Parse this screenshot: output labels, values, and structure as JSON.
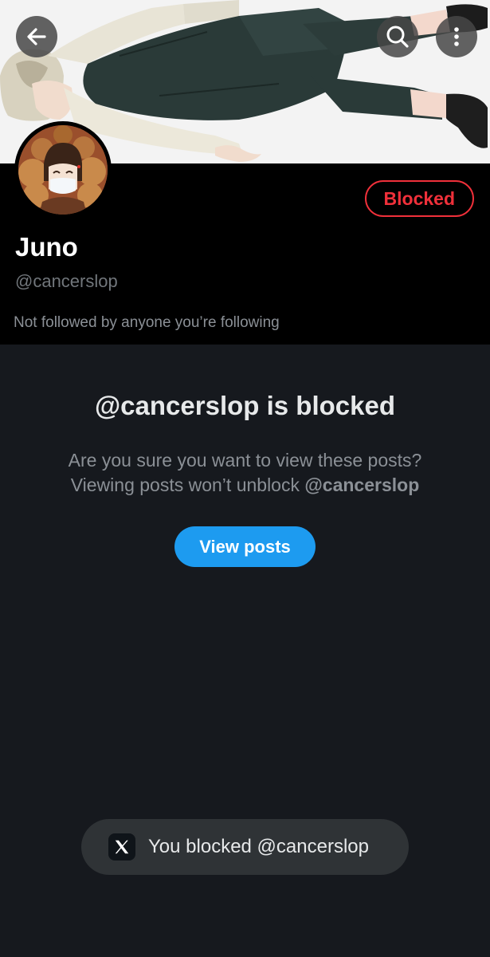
{
  "profile": {
    "display_name": "Juno",
    "handle": "@cancerslop",
    "followed_by": "Not followed by anyone you’re following",
    "blocked_button_label": "Blocked"
  },
  "header": {
    "back_icon": "arrow-left-icon",
    "search_icon": "search-icon",
    "more_icon": "more-vertical-icon"
  },
  "blocked_notice": {
    "title": "@cancerslop is blocked",
    "line1": "Are you sure you want to view these posts?",
    "line2_prefix": "Viewing posts won’t unblock ",
    "line2_handle": "@cancerslop",
    "view_posts_label": "View posts"
  },
  "toast": {
    "logo_icon": "x-logo-icon",
    "message": "You blocked @cancerslop"
  },
  "colors": {
    "background": "#16191e",
    "header_background": "#000000",
    "blocked_red": "#f0303a",
    "accent_blue": "#1d9bf0",
    "toast_background": "#2f3336"
  }
}
